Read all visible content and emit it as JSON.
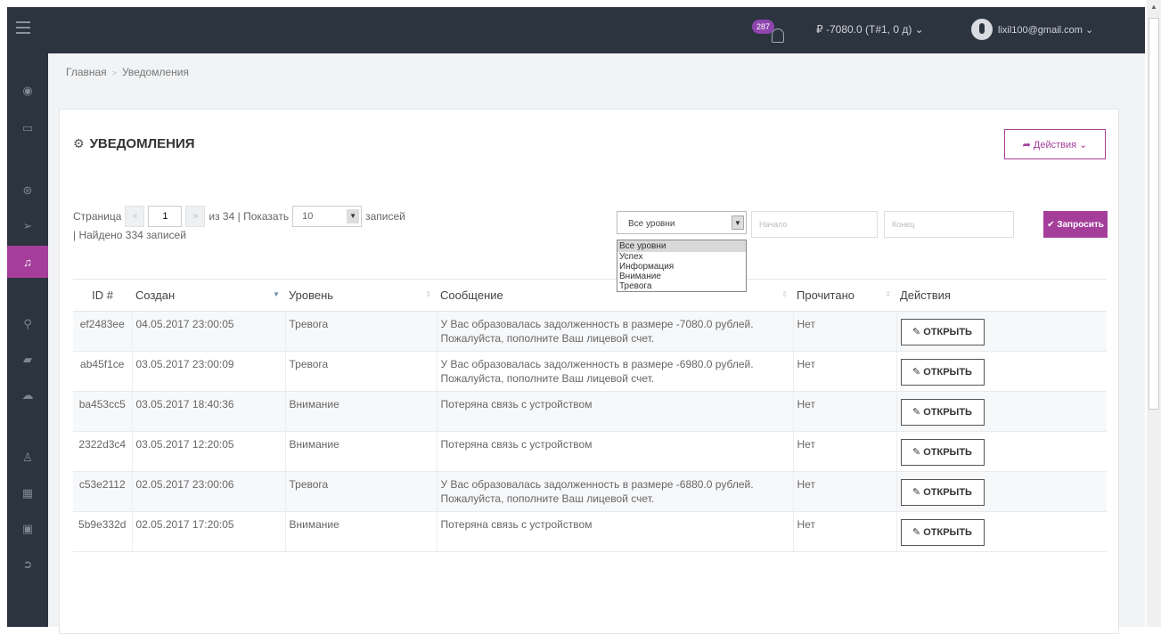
{
  "topbar": {
    "notif_count": "287",
    "balance": "₽ -7080.0 (T#1, 0 д) ⌄",
    "email": "lixil100@gmail.com ⌄"
  },
  "breadcrumb": {
    "home": "Главная",
    "current": "Уведомления"
  },
  "panel": {
    "title": "УВЕДОМЛЕНИЯ",
    "actions_label": "➦ Действия ⌄"
  },
  "pager": {
    "page_label": "Страница",
    "page_value": "1",
    "of_label": "из 34 | Показать",
    "per_page": "10",
    "records_label": "записей",
    "found": "| Найдено 334 записей"
  },
  "filter": {
    "level_selected": "Все уровни",
    "level_options": [
      "Все уровни",
      "Успех",
      "Информация",
      "Внимание",
      "Тревога"
    ],
    "start_placeholder": "Начало",
    "end_placeholder": "Конец",
    "query_label": "✔ Запросить"
  },
  "table": {
    "headers": [
      "ID #",
      "Создан",
      "Уровень",
      "Сообщение",
      "Прочитано",
      "Действия"
    ],
    "open_label": "ОТКРЫТЬ",
    "rows": [
      {
        "id": "ef2483ee",
        "created": "04.05.2017 23:00:05",
        "level": "Тревога",
        "message": "У Вас образовалась задолженность в размере -7080.0 рублей. Пожалуйста, пополните Ваш лицевой счет.",
        "read": "Нет"
      },
      {
        "id": "ab45f1ce",
        "created": "03.05.2017 23:00:09",
        "level": "Тревога",
        "message": "У Вас образовалась задолженность в размере -6980.0 рублей. Пожалуйста, пополните Ваш лицевой счет.",
        "read": "Нет"
      },
      {
        "id": "ba453cc5",
        "created": "03.05.2017 18:40:36",
        "level": "Внимание",
        "message": "Потеряна связь с устройством",
        "read": "Нет"
      },
      {
        "id": "2322d3c4",
        "created": "03.05.2017 12:20:05",
        "level": "Внимание",
        "message": "Потеряна связь с устройством",
        "read": "Нет"
      },
      {
        "id": "c53e2112",
        "created": "02.05.2017 23:00:06",
        "level": "Тревога",
        "message": "У Вас образовалась задолженность в размере -6880.0 рублей. Пожалуйста, пополните Ваш лицевой счет.",
        "read": "Нет"
      },
      {
        "id": "5b9e332d",
        "created": "02.05.2017 17:20:05",
        "level": "Внимание",
        "message": "Потеряна связь с устройством",
        "read": "Нет"
      }
    ]
  },
  "colors": {
    "accent": "#a43e9a",
    "topbar": "#2c3440"
  }
}
